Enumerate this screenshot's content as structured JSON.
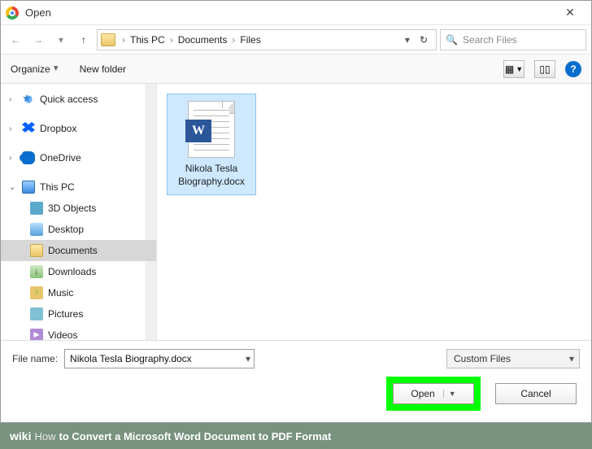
{
  "window": {
    "title": "Open",
    "close": "✕"
  },
  "nav": {
    "back": "←",
    "fwd": "→",
    "up": "↑",
    "crumbs": [
      "This PC",
      "Documents",
      "Files"
    ],
    "refresh": "↻"
  },
  "search": {
    "placeholder": "Search Files",
    "icon": "🔍"
  },
  "toolbar": {
    "organize": "Organize",
    "newfolder": "New folder",
    "help": "?"
  },
  "tree": {
    "quick": "Quick access",
    "dropbox": "Dropbox",
    "onedrive": "OneDrive",
    "thispc": "This PC",
    "children": {
      "obj3d": "3D Objects",
      "desktop": "Desktop",
      "documents": "Documents",
      "downloads": "Downloads",
      "music": "Music",
      "pictures": "Pictures",
      "videos": "Videos"
    }
  },
  "file": {
    "name_multiline": "Nikola Tesla Biography.docx",
    "line1": "Nikola Tesla",
    "line2": "Biography.docx",
    "wletter": "W"
  },
  "footer": {
    "label": "File name:",
    "value": "Nikola Tesla Biography.docx",
    "filter": "Custom Files",
    "open": "Open",
    "cancel": "Cancel"
  },
  "caption": {
    "wiki": "wiki",
    "how": "How",
    "text": " to Convert a Microsoft Word Document to PDF Format"
  }
}
